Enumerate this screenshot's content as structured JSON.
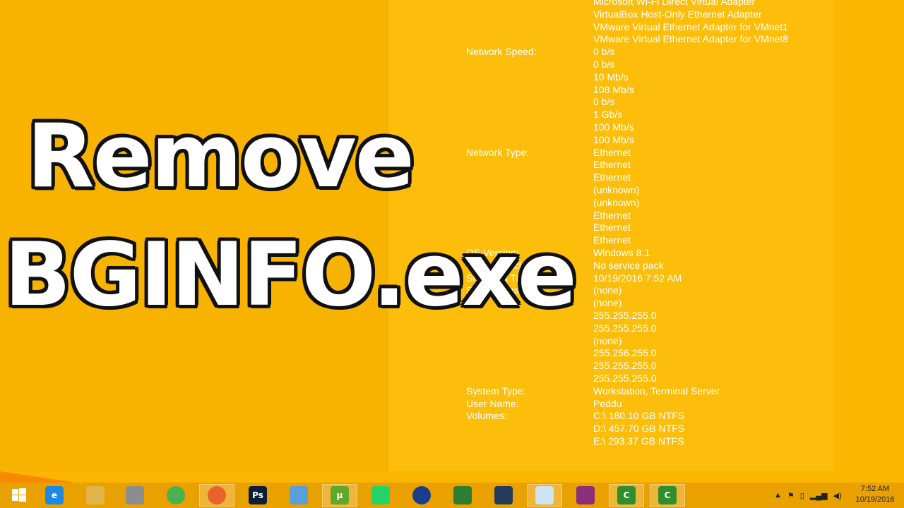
{
  "overlay": {
    "line1": "Remove",
    "line2": "BGINFO.exe"
  },
  "bginfo": {
    "rows": [
      {
        "label": "",
        "value": "Microsoft Wi-Fi Direct Virtual Adapter"
      },
      {
        "label": "",
        "value": "VirtualBox Host-Only Ethernet Adapter"
      },
      {
        "label": "",
        "value": "VMware Virtual Ethernet Adapter for VMnet1"
      },
      {
        "label": "",
        "value": "VMware Virtual Ethernet Adapter for VMnet8"
      },
      {
        "label": "Network Speed:",
        "value": "0 b/s"
      },
      {
        "label": "",
        "value": "0 b/s"
      },
      {
        "label": "",
        "value": "10 Mb/s"
      },
      {
        "label": "",
        "value": "108 Mb/s"
      },
      {
        "label": "",
        "value": "0 b/s"
      },
      {
        "label": "",
        "value": "1 Gb/s"
      },
      {
        "label": "",
        "value": "100 Mb/s"
      },
      {
        "label": "",
        "value": "100 Mb/s"
      },
      {
        "label": "Network Type:",
        "value": "Ethernet"
      },
      {
        "label": "",
        "value": "Ethernet"
      },
      {
        "label": "",
        "value": "Ethernet"
      },
      {
        "label": "",
        "value": "(unknown)"
      },
      {
        "label": "",
        "value": "(unknown)"
      },
      {
        "label": "",
        "value": "Ethernet"
      },
      {
        "label": "",
        "value": "Ethernet"
      },
      {
        "label": "",
        "value": "Ethernet"
      },
      {
        "label": "OS Version:",
        "value": "Windows 8.1"
      },
      {
        "label": "Service Pack:",
        "value": "No service pack"
      },
      {
        "label": "Snapshot Time:",
        "value": "10/19/2016 7:52 AM"
      },
      {
        "label": "Subnet Mask:",
        "value": "(none)"
      },
      {
        "label": "",
        "value": "(none)"
      },
      {
        "label": "",
        "value": "255.255.255.0"
      },
      {
        "label": "",
        "value": "255.255.255.0"
      },
      {
        "label": "",
        "value": "(none)"
      },
      {
        "label": "",
        "value": "255.256.255.0"
      },
      {
        "label": "",
        "value": "255.255.255.0"
      },
      {
        "label": "",
        "value": "255.255.255.0"
      },
      {
        "label": "System Type:",
        "value": "Workstation, Terminal Server"
      },
      {
        "label": "User Name:",
        "value": "Peddu"
      },
      {
        "label": "Volumes:",
        "value": "C:\\ 180.10 GB NTFS"
      },
      {
        "label": "",
        "value": "D:\\ 457.70 GB NTFS"
      },
      {
        "label": "",
        "value": "E:\\ 293.37 GB NTFS"
      }
    ]
  },
  "taskbar": {
    "items": [
      {
        "name": "start-button",
        "icon": "windows-logo",
        "glyph": "",
        "color": "#1f6fd0",
        "active": false
      },
      {
        "name": "internet-explorer",
        "icon": "ie-icon",
        "glyph": "e",
        "color": "#1e88e5",
        "active": false
      },
      {
        "name": "file-explorer",
        "icon": "folder-icon",
        "glyph": "",
        "color": "#e0b64a",
        "active": false
      },
      {
        "name": "app-wall",
        "icon": "wall-icon",
        "glyph": "",
        "color": "#8d8d8d",
        "active": false
      },
      {
        "name": "chrome",
        "icon": "chrome-icon",
        "glyph": "",
        "color": "#4caf50",
        "active": false
      },
      {
        "name": "firefox",
        "icon": "firefox-icon",
        "glyph": "",
        "color": "#e8622a",
        "active": true
      },
      {
        "name": "photoshop",
        "icon": "photoshop-icon",
        "glyph": "Ps",
        "color": "#0b1f3a",
        "active": false
      },
      {
        "name": "window-app",
        "icon": "window-icon",
        "glyph": "",
        "color": "#5aa0d8",
        "active": false
      },
      {
        "name": "utorrent",
        "icon": "utorrent-icon",
        "glyph": "µ",
        "color": "#5fa82c",
        "active": true
      },
      {
        "name": "whatsapp",
        "icon": "whatsapp-icon",
        "glyph": "",
        "color": "#25d366",
        "active": false
      },
      {
        "name": "globe-app",
        "icon": "globe-icon",
        "glyph": "",
        "color": "#1a3f8a",
        "active": false
      },
      {
        "name": "idm",
        "icon": "download-manager-icon",
        "glyph": "",
        "color": "#2e7d32",
        "active": false
      },
      {
        "name": "ccleaner-gear",
        "icon": "gear-icon",
        "glyph": "",
        "color": "#263a5a",
        "active": false
      },
      {
        "name": "bginfo",
        "icon": "monitor-icon",
        "glyph": "",
        "color": "#cfe3f3",
        "active": true
      },
      {
        "name": "winrar",
        "icon": "winrar-icon",
        "glyph": "",
        "color": "#8b2f7a",
        "active": false
      },
      {
        "name": "camtasia-1",
        "icon": "camtasia-icon",
        "glyph": "C",
        "color": "#2f8f2f",
        "active": true
      },
      {
        "name": "camtasia-2",
        "icon": "camtasia-icon",
        "glyph": "C",
        "color": "#2f8f2f",
        "active": true
      }
    ]
  },
  "clock": {
    "time": "7:52 AM",
    "date": "10/19/2016"
  }
}
